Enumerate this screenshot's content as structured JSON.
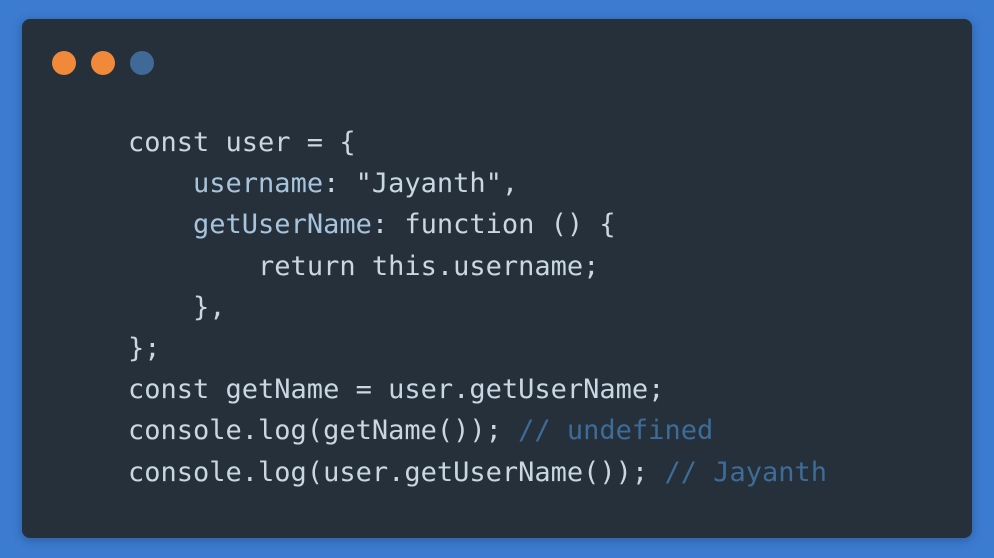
{
  "window": {
    "background": "#25303a",
    "page_background": "#3b7bd0",
    "controls": [
      {
        "name": "close",
        "color": "#f08a3a"
      },
      {
        "name": "minimize",
        "color": "#f08a3a"
      },
      {
        "name": "maximize",
        "color": "#3f6a98"
      }
    ]
  },
  "code": {
    "language": "javascript",
    "lines": [
      {
        "indent": "",
        "segments": [
          {
            "text": "const user = {",
            "kind": "plain"
          }
        ]
      },
      {
        "indent": "    ",
        "segments": [
          {
            "text": "username",
            "kind": "prop"
          },
          {
            "text": ": \"Jayanth\",",
            "kind": "plain"
          }
        ]
      },
      {
        "indent": "    ",
        "segments": [
          {
            "text": "getUserName",
            "kind": "prop"
          },
          {
            "text": ": function () {",
            "kind": "plain"
          }
        ]
      },
      {
        "indent": "        ",
        "segments": [
          {
            "text": "return this.username;",
            "kind": "plain"
          }
        ]
      },
      {
        "indent": "    ",
        "segments": [
          {
            "text": "},",
            "kind": "plain"
          }
        ]
      },
      {
        "indent": "",
        "segments": [
          {
            "text": "};",
            "kind": "plain"
          }
        ]
      },
      {
        "indent": "",
        "segments": [
          {
            "text": "const getName = user.getUserName;",
            "kind": "plain"
          }
        ]
      },
      {
        "indent": "",
        "segments": [
          {
            "text": "console.log(getName()); ",
            "kind": "plain"
          },
          {
            "text": "// undefined",
            "kind": "comment"
          }
        ]
      },
      {
        "indent": "",
        "segments": [
          {
            "text": "console.log(user.getUserName()); ",
            "kind": "plain"
          },
          {
            "text": "// Jayanth",
            "kind": "comment"
          }
        ]
      }
    ]
  }
}
